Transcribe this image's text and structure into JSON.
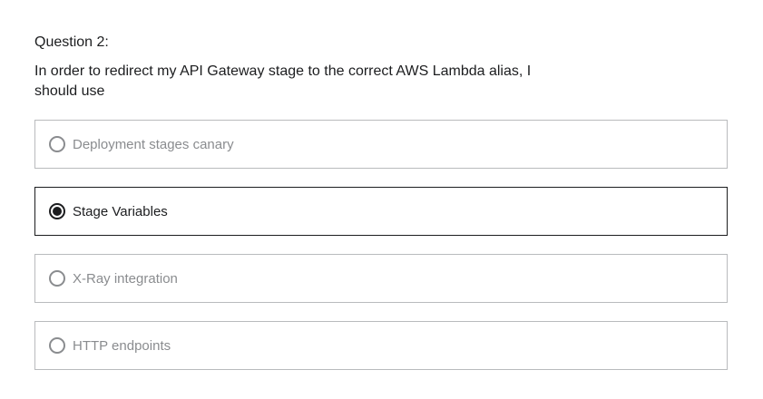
{
  "question": {
    "number_label": "Question 2:",
    "prompt": "In order to redirect my API Gateway stage to the correct AWS Lambda alias, I should use"
  },
  "answers": [
    {
      "label": "Deployment stages canary",
      "selected": false
    },
    {
      "label": "Stage Variables",
      "selected": true
    },
    {
      "label": "X-Ray integration",
      "selected": false
    },
    {
      "label": "HTTP endpoints",
      "selected": false
    }
  ],
  "colors": {
    "text": "#1c1d1f",
    "muted_text": "#8a8c8f",
    "border": "#b9bbbd",
    "selected_border": "#1c1d1f"
  }
}
